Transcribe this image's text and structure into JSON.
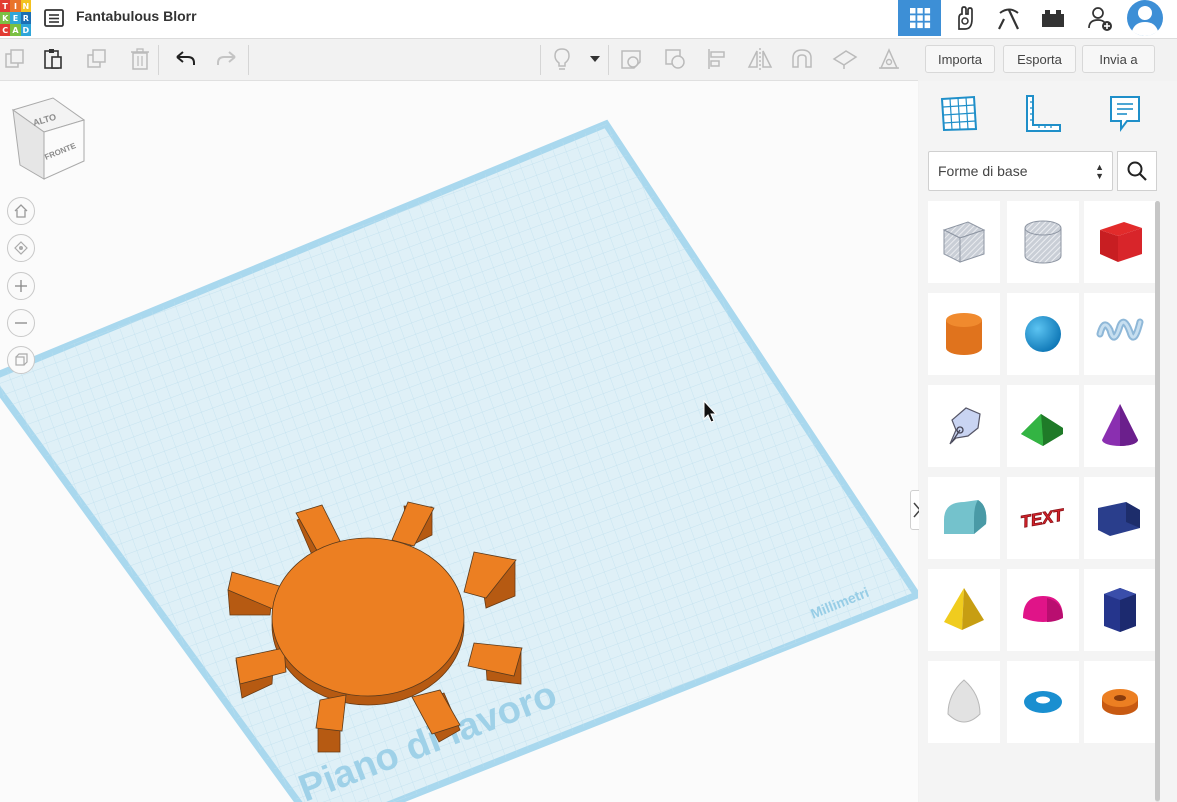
{
  "app": {
    "logo_letters": [
      "T",
      "I",
      "N",
      "K",
      "E",
      "R",
      "C",
      "A",
      "D"
    ],
    "logo_colors": [
      "#e23b32",
      "#e9732a",
      "#f3c21f",
      "#7bc043",
      "#2fa6d9",
      "#1c6fb3",
      "#e23b32",
      "#7bc043",
      "#2fa6d9"
    ],
    "title": "Fantabulous Blorr"
  },
  "topbar_buttons": [
    {
      "name": "grid-view-icon",
      "active": true
    },
    {
      "name": "circuits-hand-icon",
      "active": false
    },
    {
      "name": "pickaxe-icon",
      "active": false
    },
    {
      "name": "bricks-icon",
      "active": false
    },
    {
      "name": "add-user-icon",
      "active": false
    },
    {
      "name": "avatar-icon",
      "active": false
    }
  ],
  "toolbar": {
    "left_icons": [
      "copy-icon",
      "paste-icon",
      "duplicate-icon",
      "delete-icon",
      "undo-icon",
      "redo-icon"
    ],
    "right_icons": [
      "light-bulb-icon",
      "dropdown-icon",
      "note-icon",
      "group-icon",
      "align-icon",
      "mirror-icon",
      "magnet-icon",
      "workplane-icon",
      "ruler-icon"
    ],
    "import_label": "Importa",
    "export_label": "Esporta",
    "send_label": "Invia a"
  },
  "view_cube": {
    "top_label": "ALTO",
    "front_label": "FRONTE"
  },
  "nav_controls": [
    "home-icon",
    "fit-view-icon",
    "zoom-in-icon",
    "zoom-out-icon",
    "ortho-view-icon"
  ],
  "workplane": {
    "label": "Piano di lavoro",
    "units": "Millimetri",
    "color": "#d7eef6",
    "border_color": "#aadaf0"
  },
  "gear": {
    "color": "#ec7f22",
    "side_color": "#b85a12",
    "teeth": 8
  },
  "panel": {
    "top_icons": [
      "workplane-grid-icon",
      "ruler-icon",
      "notes-icon"
    ],
    "library_label": "Forme di base",
    "shapes": [
      {
        "name": "box-hole-shape"
      },
      {
        "name": "cylinder-hole-shape"
      },
      {
        "name": "box-shape"
      },
      {
        "name": "cylinder-shape"
      },
      {
        "name": "sphere-shape"
      },
      {
        "name": "scribble-shape"
      },
      {
        "name": "shape-generator-shape"
      },
      {
        "name": "roof-shape"
      },
      {
        "name": "cone-shape"
      },
      {
        "name": "round-roof-shape"
      },
      {
        "name": "text-shape",
        "text": "TEXT"
      },
      {
        "name": "wedge-shape"
      },
      {
        "name": "pyramid-shape"
      },
      {
        "name": "half-sphere-shape"
      },
      {
        "name": "polygon-shape"
      },
      {
        "name": "paraboloid-shape"
      },
      {
        "name": "torus-shape"
      },
      {
        "name": "tube-shape"
      }
    ]
  }
}
